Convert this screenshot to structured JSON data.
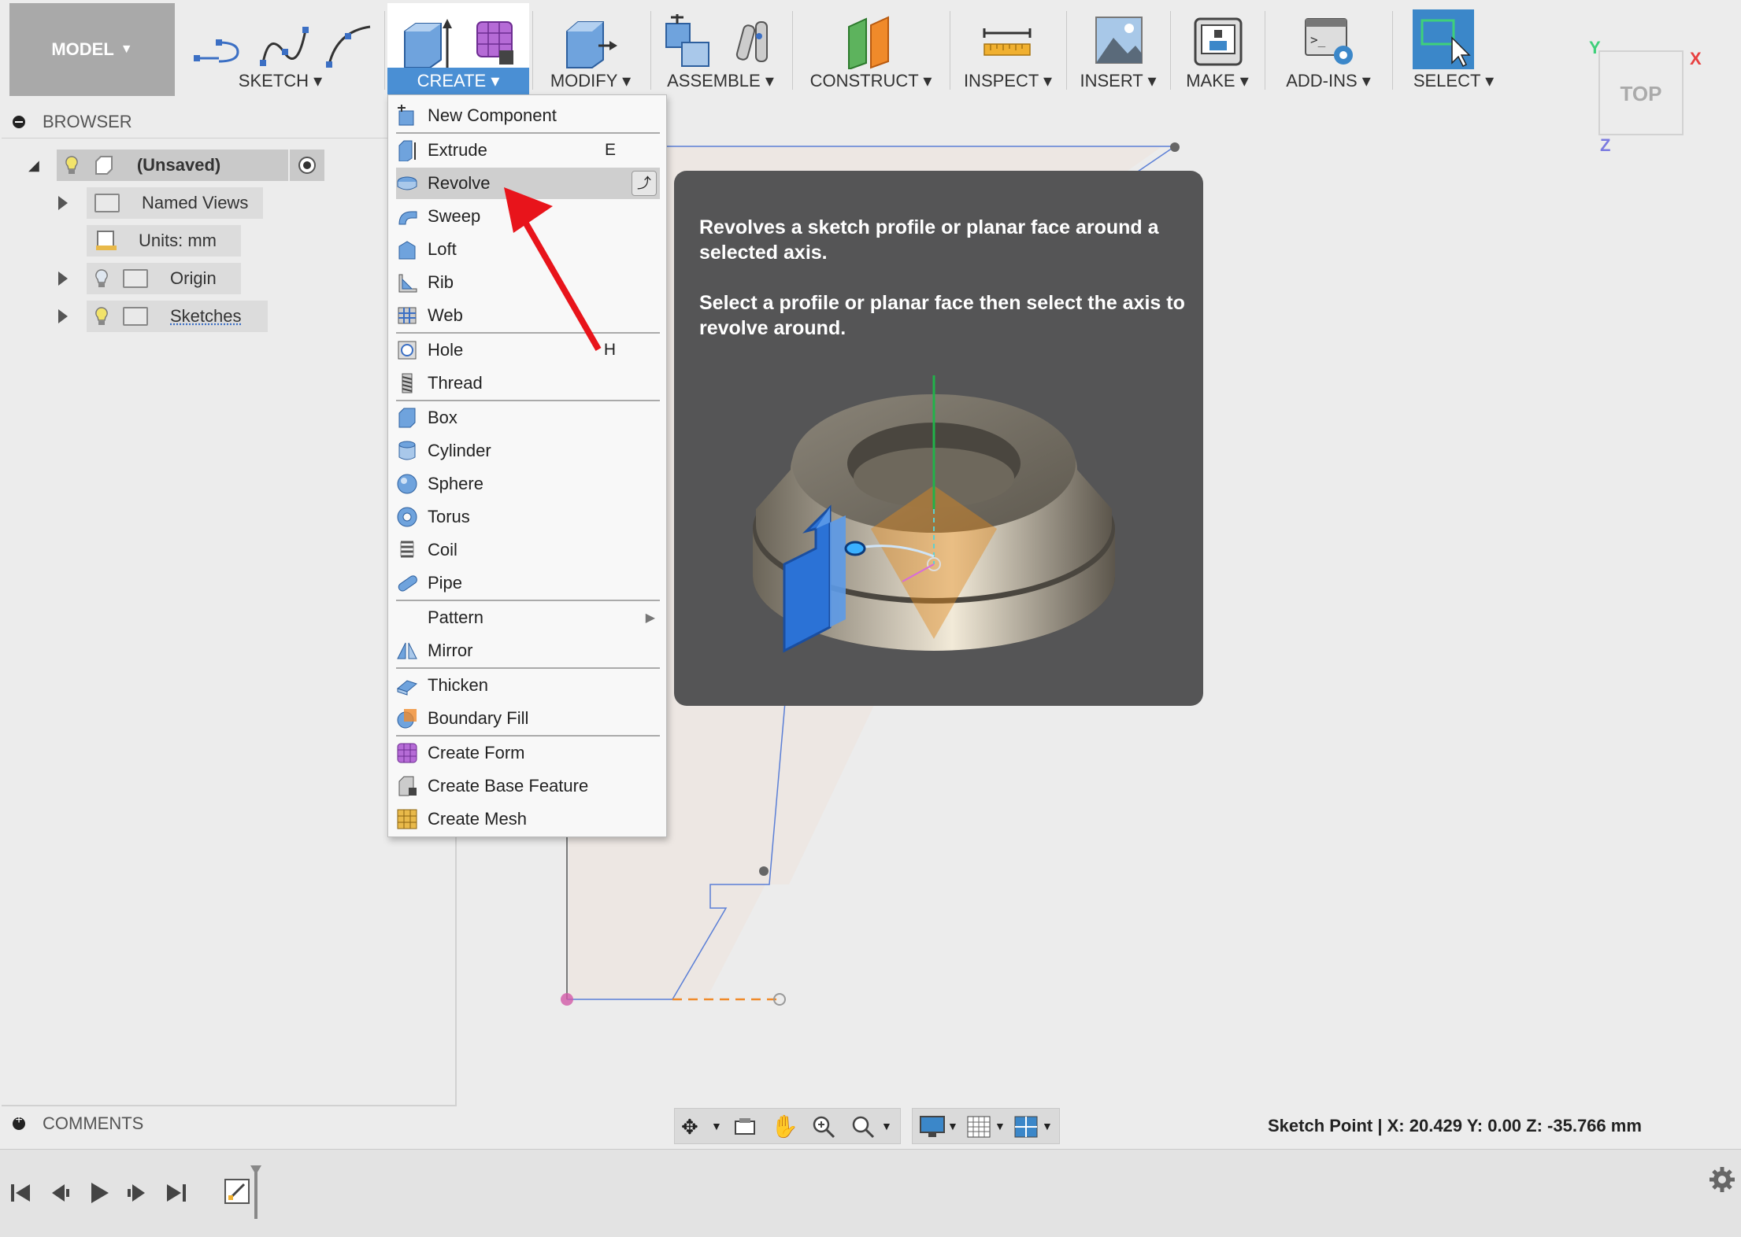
{
  "toolbar": {
    "model_label": "MODEL",
    "groups": {
      "sketch": "SKETCH",
      "create": "CREATE",
      "modify": "MODIFY",
      "assemble": "ASSEMBLE",
      "construct": "CONSTRUCT",
      "inspect": "INSPECT",
      "insert": "INSERT",
      "make": "MAKE",
      "addins": "ADD-INS",
      "select": "SELECT"
    }
  },
  "viewcube": {
    "face": "TOP",
    "axis_y": "Y",
    "axis_x": "X",
    "axis_z": "Z"
  },
  "browser": {
    "title": "BROWSER",
    "root": "(Unsaved)",
    "items": {
      "named_views": "Named Views",
      "units": "Units: mm",
      "origin": "Origin",
      "sketches": "Sketches"
    }
  },
  "comments": {
    "title": "COMMENTS"
  },
  "create_menu": {
    "new_component": "New Component",
    "extrude": "Extrude",
    "extrude_shortcut": "E",
    "revolve": "Revolve",
    "sweep": "Sweep",
    "loft": "Loft",
    "rib": "Rib",
    "web": "Web",
    "hole": "Hole",
    "hole_shortcut": "H",
    "thread": "Thread",
    "box": "Box",
    "cylinder": "Cylinder",
    "sphere": "Sphere",
    "torus": "Torus",
    "coil": "Coil",
    "pipe": "Pipe",
    "pattern": "Pattern",
    "mirror": "Mirror",
    "thicken": "Thicken",
    "boundary_fill": "Boundary Fill",
    "create_form": "Create Form",
    "create_base_feature": "Create Base Feature",
    "create_mesh": "Create Mesh"
  },
  "tooltip": {
    "line1": "Revolves a sketch profile or planar face around a selected axis.",
    "line2": "Select a profile or planar face then select the axis to revolve around."
  },
  "status": {
    "text": "Sketch Point | X: 20.429 Y: 0.00 Z: -35.766 mm"
  },
  "colors": {
    "accent_blue": "#4a8fd4",
    "select_blue": "#3b87c9",
    "arrow_red": "#e8141b",
    "tooltip_bg": "#555556",
    "sketch_line": "#5b7fd6",
    "profile_fill": "#efe3dc"
  }
}
